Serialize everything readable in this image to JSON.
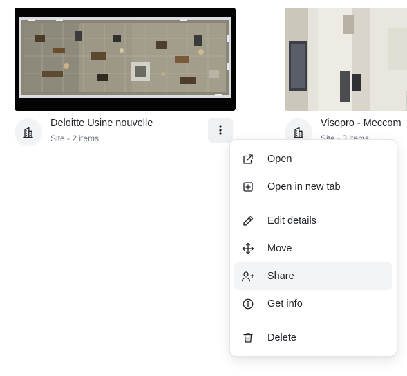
{
  "cards": [
    {
      "title": "Deloitte Usine nouvelle",
      "subtitle": "Site - 2 items",
      "thumbnail": "floorplan-scan",
      "icon": "building-icon"
    },
    {
      "title": "Visopro - Meccom",
      "subtitle": "Site - 3 items",
      "thumbnail": "interior-photo",
      "icon": "building-icon"
    }
  ],
  "menu": {
    "items": [
      {
        "label": "Open",
        "icon": "external-link-icon"
      },
      {
        "label": "Open in new tab",
        "icon": "plus-square-icon"
      },
      {
        "label": "Edit details",
        "icon": "pencil-icon"
      },
      {
        "label": "Move",
        "icon": "move-arrows-icon"
      },
      {
        "label": "Share",
        "icon": "user-plus-icon",
        "hovered": true
      },
      {
        "label": "Get info",
        "icon": "info-icon"
      },
      {
        "label": "Delete",
        "icon": "trash-icon"
      }
    ]
  },
  "colors": {
    "text": "#1f2328",
    "muted": "#6b7280",
    "hover": "#f3f4f5",
    "border": "#e4e6ea"
  }
}
